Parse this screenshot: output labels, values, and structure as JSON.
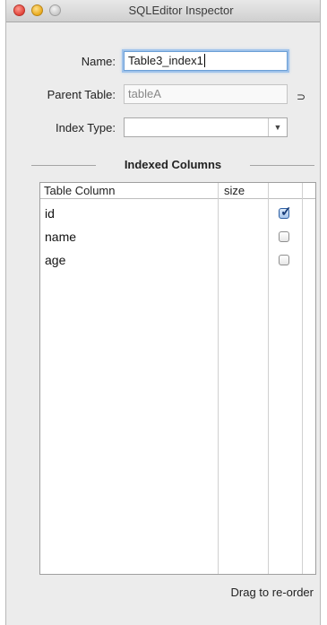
{
  "window": {
    "title": "SQLEditor Inspector"
  },
  "form": {
    "name_label": "Name:",
    "name_value": "Table3_index1",
    "parent_label": "Parent Table:",
    "parent_value": "tableA",
    "index_type_label": "Index Type:",
    "index_type_value": ""
  },
  "section": {
    "title": "Indexed Columns"
  },
  "table": {
    "headers": [
      "Table Column",
      "size",
      ""
    ],
    "rows": [
      {
        "column": "id",
        "size": "",
        "checked": true
      },
      {
        "column": "name",
        "size": "",
        "checked": false
      },
      {
        "column": "age",
        "size": "",
        "checked": false
      }
    ]
  },
  "footer": {
    "hint": "Drag to re-order"
  },
  "icons": {
    "link": "link-icon",
    "dropdown": "chevron-down-icon"
  },
  "colors": {
    "focus_ring": "#6b9fd6",
    "check_accent": "#2d5fa3"
  }
}
